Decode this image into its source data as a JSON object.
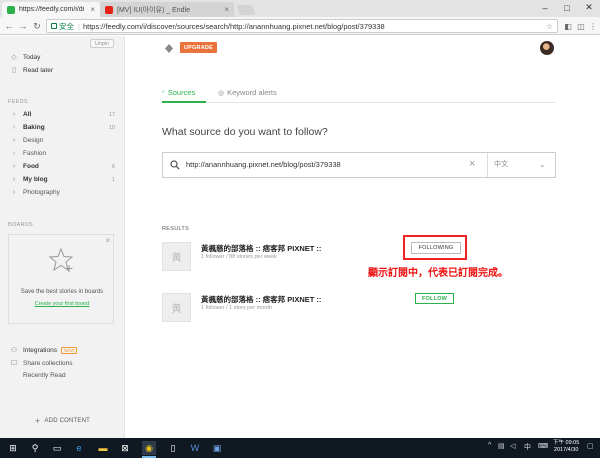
{
  "browser": {
    "tabs": [
      {
        "title": "https://feedly.com/i/di",
        "favicon_color": "#2bb24c"
      },
      {
        "title": "[MV] IU(아이유) _ Endle",
        "favicon_color": "#e62117"
      }
    ],
    "address": {
      "secure_label": "安全",
      "url": "https://feedly.com/i/discover/sources/search/http://anannhuang.pixnet.net/blog/post/379338"
    }
  },
  "sidebar": {
    "unpin": "Unpin",
    "top_items": [
      {
        "label": "Today",
        "icon": "today-icon"
      },
      {
        "label": "Read later",
        "icon": "bookmark-icon"
      }
    ],
    "feeds_header": "FEEDS",
    "feeds": [
      {
        "label": "All",
        "count": "17",
        "bold": true
      },
      {
        "label": "Baking",
        "count": "10",
        "bold": true
      },
      {
        "label": "Design",
        "count": "",
        "bold": false
      },
      {
        "label": "Fashion",
        "count": "",
        "bold": false
      },
      {
        "label": "Food",
        "count": "6",
        "bold": true
      },
      {
        "label": "My blog",
        "count": "1",
        "bold": true
      },
      {
        "label": "Photography",
        "count": "",
        "bold": false
      }
    ],
    "boards_header": "BOARDS",
    "boards_card": {
      "text": "Save the best stories in boards",
      "link": "Create your first board"
    },
    "bottom_items": [
      {
        "label": "Integrations",
        "badge": "NEW"
      },
      {
        "label": "Share collections"
      },
      {
        "label": "Recently Read"
      }
    ],
    "add_content": "ADD CONTENT"
  },
  "main": {
    "upgrade": "UPGRADE",
    "tabs": [
      {
        "label": "Sources",
        "active": true
      },
      {
        "label": "Keyword alerts",
        "active": false
      }
    ],
    "question": "What source do you want to follow?",
    "search": {
      "value": "http://anannhuang.pixnet.net/blog/post/379338",
      "language": "中文"
    },
    "results_label": "RESULTS",
    "results": [
      {
        "thumb": "黃",
        "title": "黃楓慈的部落格 :: 痞客邦 PIXNET ::",
        "meta": "1 follower / 88 stories per week",
        "button": "FOLLOWING",
        "following": true
      },
      {
        "thumb": "黃",
        "title": "黃楓慈的部落格 :: 痞客邦 PIXNET ::",
        "meta": "1 follower / 1 story per month",
        "button": "FOLLOW",
        "following": false
      }
    ],
    "annotation": "顯示訂閱中，代表已訂閱完成。"
  },
  "taskbar": {
    "time": "下午 09:05",
    "date": "2017/4/30"
  },
  "colors": {
    "accent": "#2bb24c",
    "upgrade": "#e9733b",
    "annotation": "#e11111"
  }
}
